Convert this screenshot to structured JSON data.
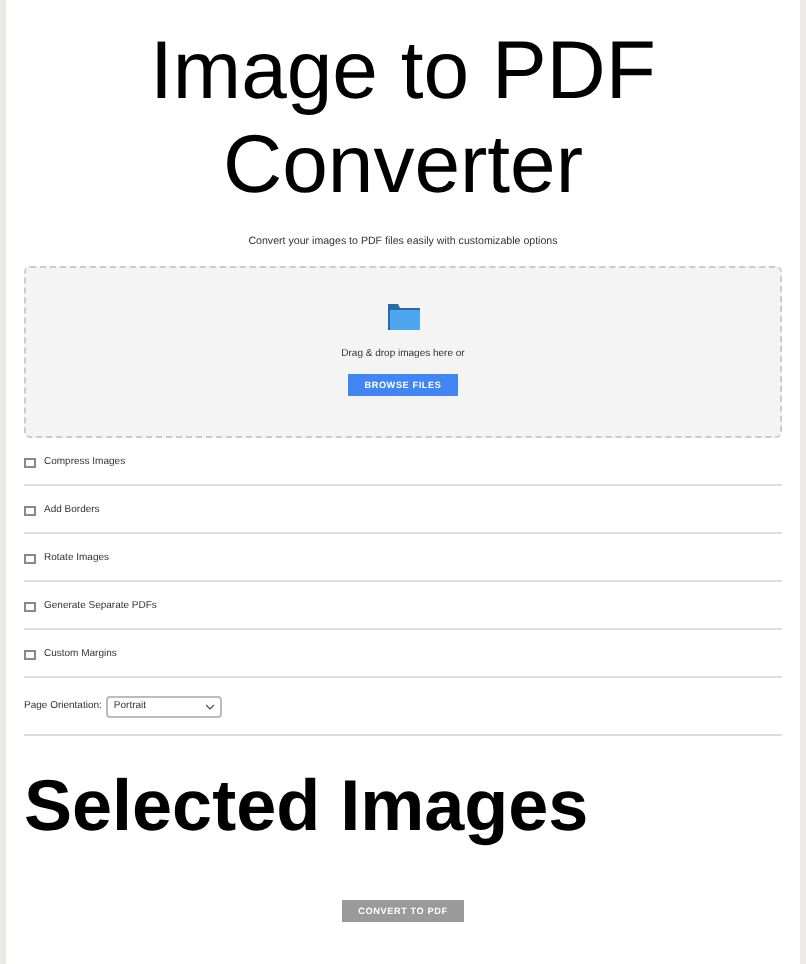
{
  "title": "Image to PDF Converter",
  "subtitle": "Convert your images to PDF files easily with customizable options",
  "drop_zone": {
    "text": "Drag & drop images here or",
    "button": "BROWSE FILES"
  },
  "options": [
    {
      "label": "Compress Images",
      "checked": false
    },
    {
      "label": "Add Borders",
      "checked": false
    },
    {
      "label": "Rotate Images",
      "checked": false
    },
    {
      "label": "Generate Separate PDFs",
      "checked": false
    },
    {
      "label": "Custom Margins",
      "checked": false
    }
  ],
  "orientation": {
    "label": "Page Orientation:",
    "value": "Portrait"
  },
  "selected_heading": "Selected Images",
  "convert_button": {
    "label": "CONVERT TO PDF",
    "disabled": true
  }
}
